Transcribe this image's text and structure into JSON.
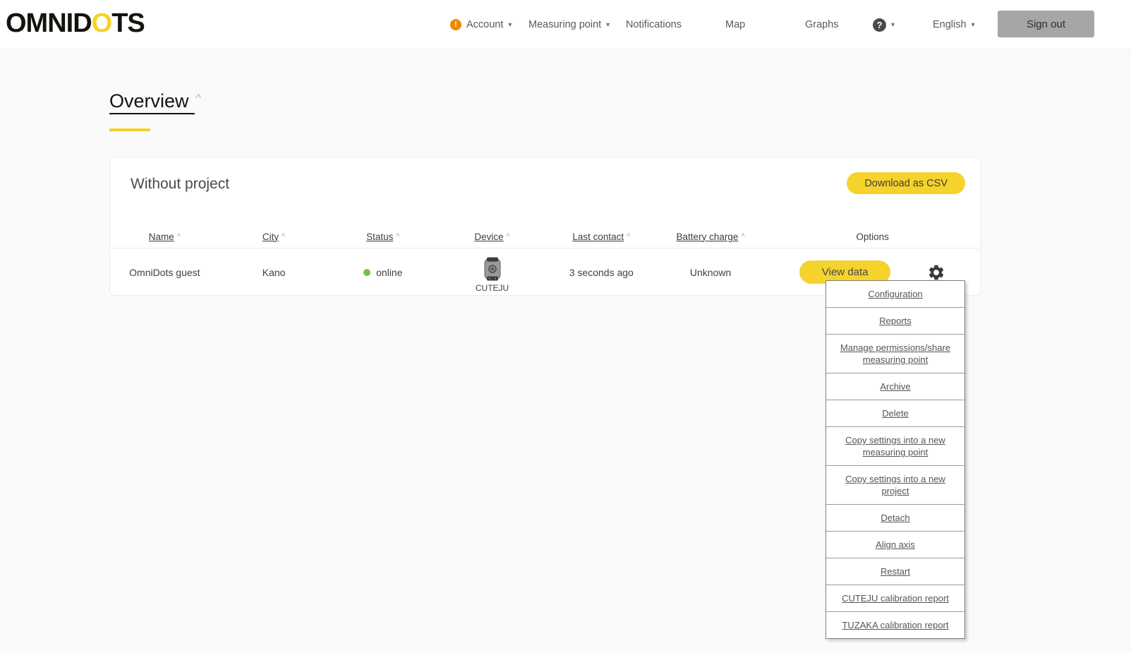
{
  "brand": {
    "logo_prefix": "OMNID",
    "logo_accent": "O",
    "logo_suffix": "TS"
  },
  "nav": {
    "warning_glyph": "!",
    "account_label": "Account",
    "measuring_point_label": "Measuring point",
    "notifications_label": "Notifications",
    "map_label": "Map",
    "graphs_label": "Graphs",
    "help_glyph": "?",
    "language_label": "English",
    "sign_out_label": "Sign out",
    "caret_glyph": "▾"
  },
  "page": {
    "title": "Overview",
    "collapse_caret": "^"
  },
  "card": {
    "title": "Without project",
    "download_csv_label": "Download as CSV"
  },
  "table": {
    "sort_caret": "^",
    "headers": [
      {
        "label": "Name",
        "sortable": true
      },
      {
        "label": "City",
        "sortable": true
      },
      {
        "label": "Status",
        "sortable": true
      },
      {
        "label": "Device",
        "sortable": true
      },
      {
        "label": "Last contact",
        "sortable": true
      },
      {
        "label": "Battery charge",
        "sortable": true
      },
      {
        "label": "Options",
        "sortable": false
      }
    ],
    "row": {
      "name": "OmniDots guest",
      "city": "Kano",
      "status": "online",
      "device": "CUTEJU",
      "last_contact": "3 seconds ago",
      "battery_charge": "Unknown",
      "view_data_label": "View data"
    }
  },
  "menu": {
    "items": [
      "Configuration",
      "Reports",
      "Manage permissions/share measuring point",
      "Archive",
      "Delete",
      "Copy settings into a new measuring point",
      "Copy settings into a new project",
      "Detach",
      "Align axis",
      "Restart",
      "CUTEJU calibration report",
      "TUZAKA calibration report"
    ]
  },
  "colors": {
    "accent_yellow": "#f5d32c",
    "online_green": "#76c043",
    "warning_orange": "#ef8807",
    "signout_gray": "#a6a6a6"
  }
}
